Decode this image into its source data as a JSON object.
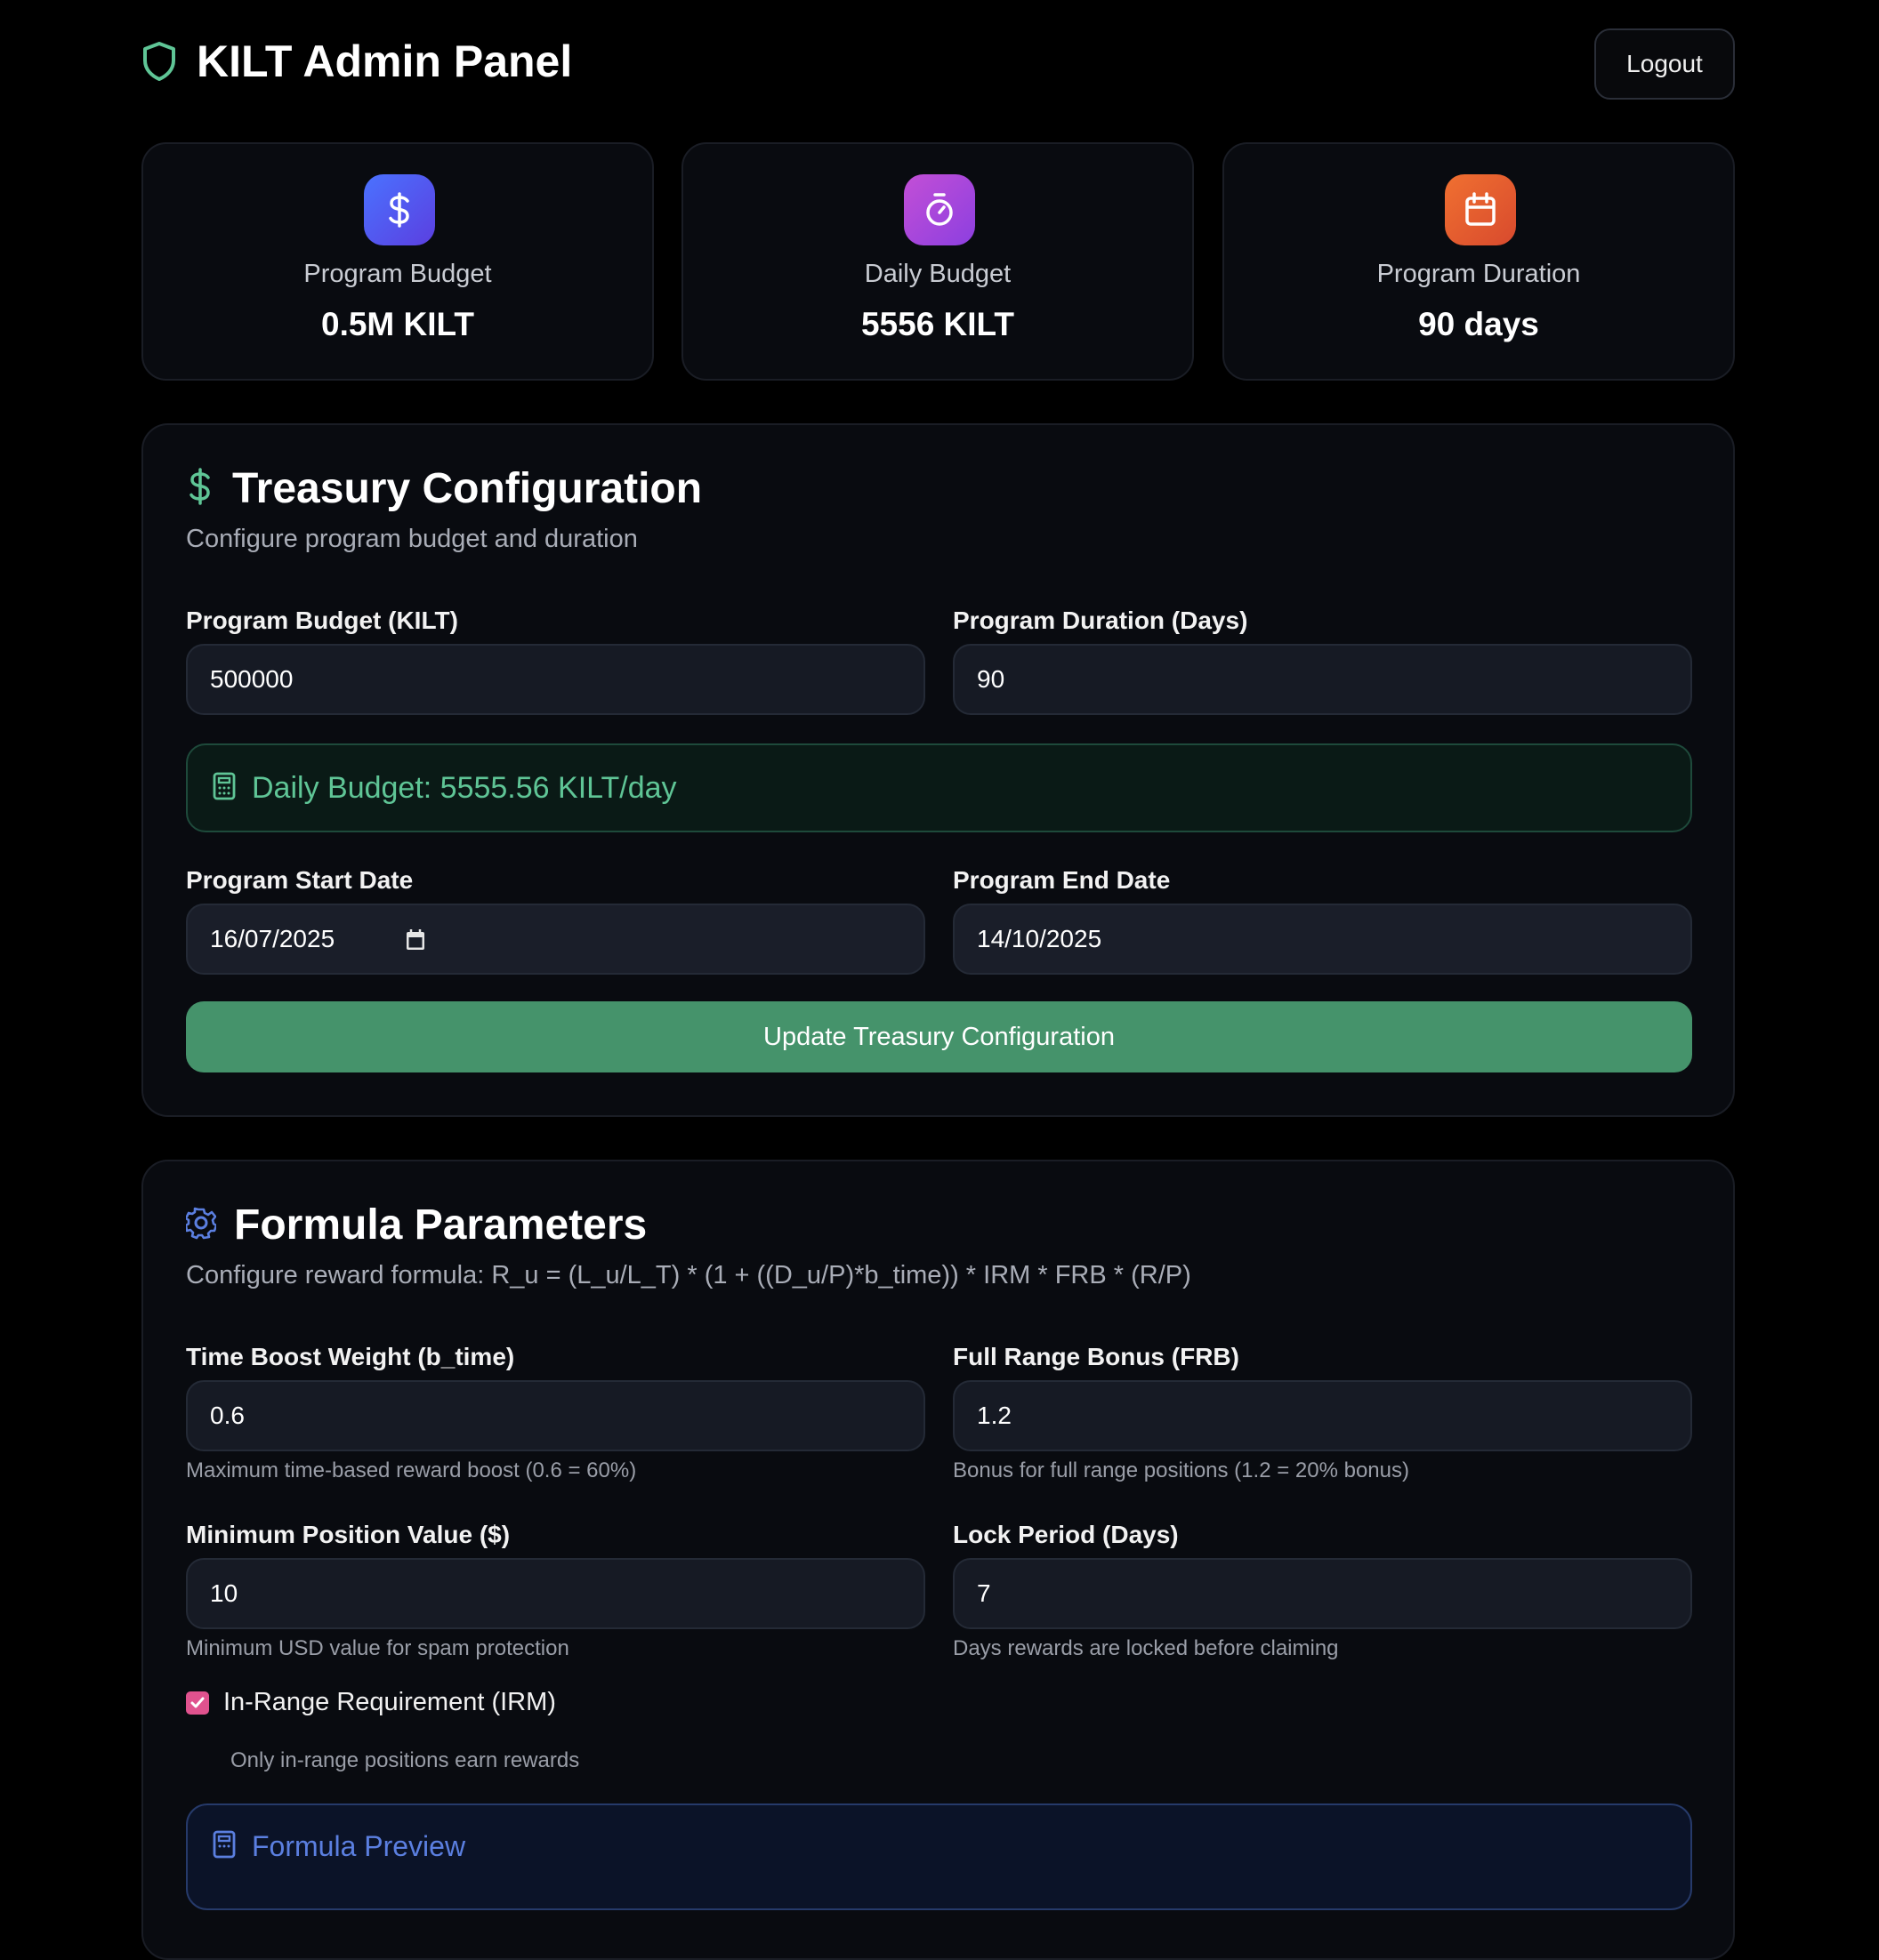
{
  "header": {
    "title": "KILT Admin Panel",
    "logout_label": "Logout"
  },
  "stats": [
    {
      "label": "Program Budget",
      "value": "0.5M KILT",
      "icon": "dollar-icon",
      "color": "#4f5ef0"
    },
    {
      "label": "Daily Budget",
      "value": "5556 KILT",
      "icon": "timer-icon",
      "color": "#b34bd8"
    },
    {
      "label": "Program Duration",
      "value": "90 days",
      "icon": "calendar-icon",
      "color": "#e8602e"
    }
  ],
  "treasury": {
    "title": "Treasury Configuration",
    "subtitle": "Configure program budget and duration",
    "budget_label": "Program Budget (KILT)",
    "budget_value": "500000",
    "duration_label": "Program Duration (Days)",
    "duration_value": "90",
    "daily_budget_text": "Daily Budget: 5555.56 KILT/day",
    "start_label": "Program Start Date",
    "start_value": "16/07/2025",
    "end_label": "Program End Date",
    "end_value": "14/10/2025",
    "update_label": "Update Treasury Configuration"
  },
  "formula": {
    "title": "Formula Parameters",
    "subtitle": "Configure reward formula: R_u = (L_u/L_T) * (1 + ((D_u/P)*b_time)) * IRM * FRB * (R/P)",
    "time_boost_label": "Time Boost Weight (b_time)",
    "time_boost_value": "0.6",
    "time_boost_hint": "Maximum time-based reward boost (0.6 = 60%)",
    "frb_label": "Full Range Bonus (FRB)",
    "frb_value": "1.2",
    "frb_hint": "Bonus for full range positions (1.2 = 20% bonus)",
    "min_pos_label": "Minimum Position Value ($)",
    "min_pos_value": "10",
    "min_pos_hint": "Minimum USD value for spam protection",
    "lock_label": "Lock Period (Days)",
    "lock_value": "7",
    "lock_hint": "Days rewards are locked before claiming",
    "irm_label": "In-Range Requirement (IRM)",
    "irm_checked": true,
    "irm_hint": "Only in-range positions earn rewards",
    "preview_title": "Formula Preview"
  },
  "colors": {
    "accent_green": "#5fc596",
    "button_green": "#45936b",
    "accent_blue": "#5b7fe0",
    "checkbox_pink": "#e0528e"
  }
}
